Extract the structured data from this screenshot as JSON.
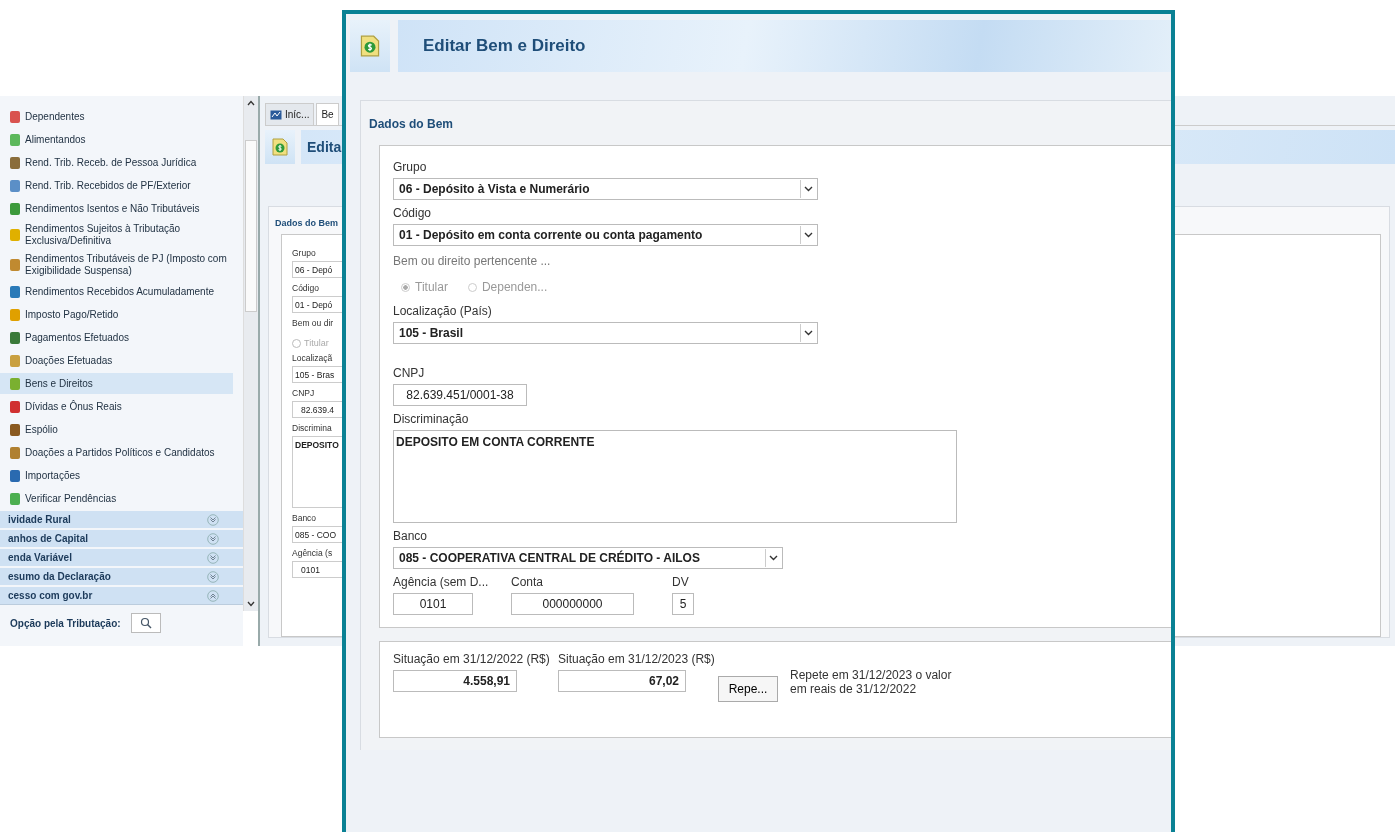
{
  "sidebar": {
    "items": [
      {
        "label": "Dependentes",
        "selected": false
      },
      {
        "label": "Alimentandos",
        "selected": false
      },
      {
        "label": "Rend. Trib. Receb. de Pessoa Jurídica",
        "selected": false
      },
      {
        "label": "Rend. Trib. Recebidos de PF/Exterior",
        "selected": false
      },
      {
        "label": "Rendimentos Isentos e Não Tributáveis",
        "selected": false
      },
      {
        "label": "Rendimentos Sujeitos à Tributação Exclusiva/Definitiva",
        "selected": false
      },
      {
        "label": "Rendimentos Tributáveis de PJ (Imposto com Exigibilidade Suspensa)",
        "selected": false
      },
      {
        "label": "Rendimentos Recebidos Acumuladamente",
        "selected": false
      },
      {
        "label": "Imposto Pago/Retido",
        "selected": false
      },
      {
        "label": "Pagamentos Efetuados",
        "selected": false
      },
      {
        "label": "Doações Efetuadas",
        "selected": false
      },
      {
        "label": "Bens e Direitos",
        "selected": true
      },
      {
        "label": "Dívidas e Ônus Reais",
        "selected": false
      },
      {
        "label": "Espólio",
        "selected": false
      },
      {
        "label": "Doações a Partidos Políticos e Candidatos",
        "selected": false
      },
      {
        "label": "Importações",
        "selected": false
      },
      {
        "label": "Verificar Pendências",
        "selected": false
      }
    ],
    "sections": [
      {
        "label": "ividade Rural",
        "expanded": false
      },
      {
        "label": "anhos de Capital",
        "expanded": false
      },
      {
        "label": "enda Variável",
        "expanded": false
      },
      {
        "label": "esumo da Declaração",
        "expanded": false
      },
      {
        "label": "cesso com gov.br",
        "expanded": true
      }
    ],
    "option_label": "Opção pela Tributação:"
  },
  "background_window": {
    "tabs": [
      {
        "label": "Iníc...",
        "selected": false
      },
      {
        "label": "Be",
        "selected": true
      }
    ],
    "title": "Edita",
    "section_title": "Dados do Bem",
    "fields": [
      {
        "kind": "select",
        "label": "Grupo",
        "value": "06 - Depó"
      },
      {
        "kind": "select",
        "label": "Código",
        "value": "01 - Depó"
      },
      {
        "kind": "radio",
        "label": "Bem ou dir",
        "value": "Titular"
      },
      {
        "kind": "select",
        "label": "Localizaçã",
        "value": "105 - Bras"
      },
      {
        "kind": "input",
        "label": "CNPJ",
        "value": "82.639.4"
      },
      {
        "kind": "textarea",
        "label": "Discrimina",
        "value": "DEPOSITO"
      },
      {
        "kind": "select",
        "label": "Banco",
        "value": "085 - COO"
      },
      {
        "kind": "input",
        "label": "Agência (s",
        "value": "0101"
      }
    ]
  },
  "editor": {
    "title": "Editar Bem e Direito",
    "section_title": "Dados do Bem",
    "grupo": {
      "label": "Grupo",
      "value": "06 - Depósito à Vista e Numerário"
    },
    "codigo": {
      "label": "Código",
      "value": "01 - Depósito em conta corrente ou conta pagamento"
    },
    "owner": {
      "label": "Bem ou direito pertencente ...",
      "disabled": true,
      "options": [
        {
          "label": "Titular",
          "selected": true
        },
        {
          "label": "Dependen...",
          "selected": false
        }
      ]
    },
    "localizacao": {
      "label": "Localização (País)",
      "value": "105 - Brasil"
    },
    "cnpj": {
      "label": "CNPJ",
      "value": "82.639.451/0001-38"
    },
    "discriminacao": {
      "label": "Discriminação",
      "value": "DEPOSITO EM CONTA CORRENTE"
    },
    "banco": {
      "label": "Banco",
      "value": "085 - COOPERATIVA CENTRAL DE CRÉDITO - AILOS"
    },
    "agencia": {
      "label": "Agência (sem D...",
      "value": "0101"
    },
    "conta": {
      "label": "Conta",
      "value": "000000000"
    },
    "dv": {
      "label": "DV",
      "value": "5"
    },
    "situacao_anterior": {
      "label": "Situação em 31/12/2022 (R$)",
      "value": "4.558,91"
    },
    "situacao_atual": {
      "label": "Situação em 31/12/2023 (R$)",
      "value": "67,02"
    },
    "repeat_button": "Repe...",
    "repeat_note": "Repete em 31/12/2023 o valor em reais de 31/12/2022"
  }
}
